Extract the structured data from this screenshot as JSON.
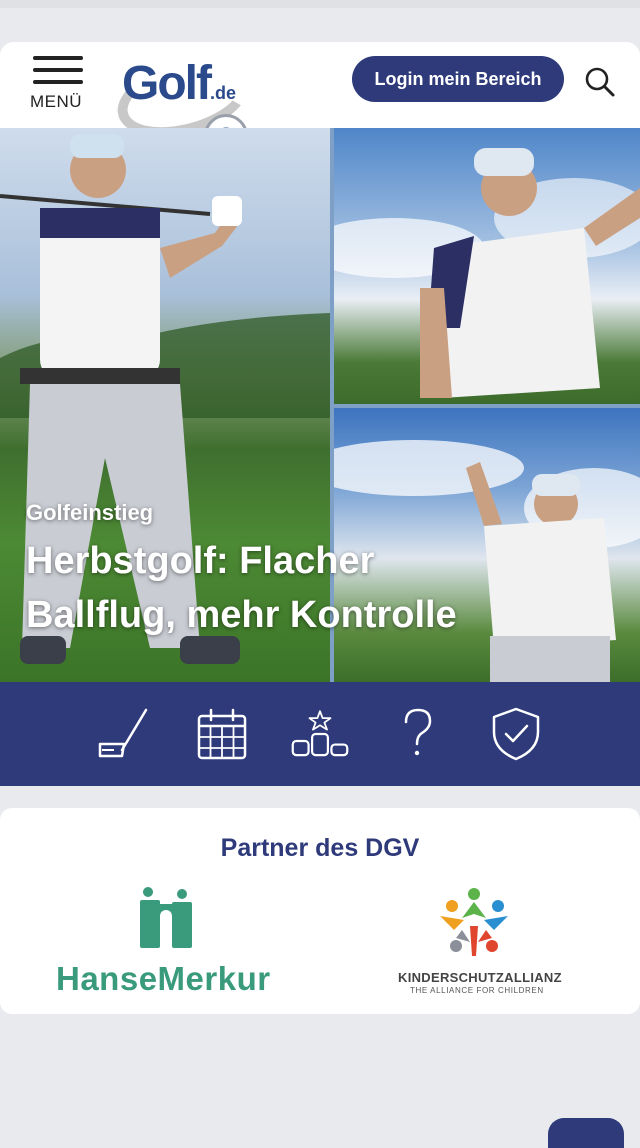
{
  "header": {
    "menu_label": "MENÜ",
    "logo_text": "Golf",
    "logo_suffix": ".de",
    "logo_seal_letter": "G",
    "login_label": "Login mein Bereich"
  },
  "hero": {
    "kicker": "Golfeinstieg",
    "title_line1": "Herbstgolf: Flacher",
    "title_line2": "Ballflug, mehr Kontrolle"
  },
  "iconbar": {
    "items": [
      "golf-club-icon",
      "calendar-icon",
      "ranking-podium-icon",
      "help-question-icon",
      "shield-check-icon"
    ]
  },
  "partner": {
    "title": "Partner des DGV",
    "hansemerkur": "HanseMerkur",
    "kinderschutz_name": "KINDERSCHUTZALLIANZ",
    "kinderschutz_sub": "THE ALLIANCE FOR CHILDREN"
  },
  "colors": {
    "brand_navy": "#2e3a7a",
    "hanse_green": "#3a9a7c",
    "background": "#e9eaee"
  }
}
